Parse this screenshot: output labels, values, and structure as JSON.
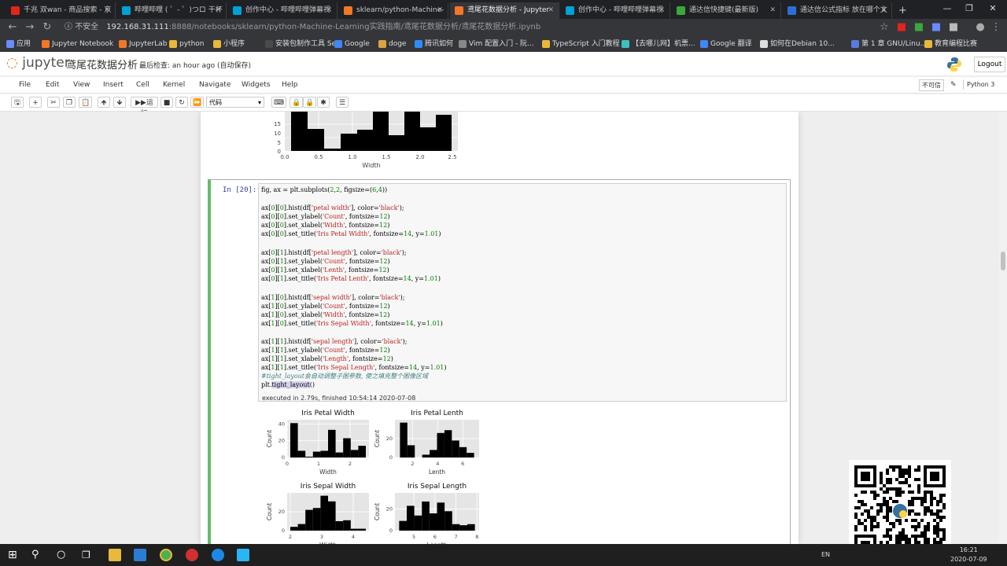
{
  "browser": {
    "tabs": [
      {
        "label": "千兆 双wan - 商品搜索 - 京",
        "color": "#e1251b",
        "icon": "jd-icon"
      },
      {
        "label": "哔哩哔哩 ( ゜- ゜)つロ 干杯",
        "color": "#00a1d6",
        "icon": "bilibili-icon"
      },
      {
        "label": "创作中心 - 哔哩哔哩弹幕视",
        "color": "#00a1d6",
        "icon": "bilibili-icon"
      },
      {
        "label": "sklearn/python-Machine-",
        "color": "#f37726",
        "icon": "jupyter-icon"
      },
      {
        "label": "鸢尾花数据分析 - Jupyter",
        "color": "#f37726",
        "icon": "jupyter-icon"
      },
      {
        "label": "创作中心 - 哔哩哔哩弹幕视",
        "color": "#00a1d6",
        "icon": "bilibili-icon"
      },
      {
        "label": "通达信快捷键(最新版)",
        "color": "#3ca83c",
        "icon": "doc-icon"
      },
      {
        "label": "通达信公式指标 放在哪个文",
        "color": "#2b6fd6",
        "icon": "baidu-icon"
      }
    ],
    "active_tab": 4,
    "new_tab": "+",
    "url_security": "不安全",
    "url_host": "192.168.31.111",
    "url_path": ":8888/notebooks/sklearn/python-Machine-Learning实践指南/鸢尾花数据分析/鸢尾花数据分析.ipynb",
    "bookmarks": [
      {
        "label": "应用",
        "color": "#6a8cff"
      },
      {
        "label": "Jupyter Notebook",
        "color": "#f37726"
      },
      {
        "label": "JupyterLab",
        "color": "#f37726"
      },
      {
        "label": "python",
        "color": "#e8b93a"
      },
      {
        "label": "小程序",
        "color": "#e8b93a"
      },
      {
        "label": "安装包制作工具 Se...",
        "color": "#4a4a4a"
      },
      {
        "label": "Google",
        "color": "#4285f4"
      },
      {
        "label": "doge",
        "color": "#d9a441"
      },
      {
        "label": "腾讯如何",
        "color": "#2e8bff"
      },
      {
        "label": "Vim 配置入门 - 阮...",
        "color": "#888888"
      },
      {
        "label": "TypeScript 入门教程",
        "color": "#e8b93a"
      },
      {
        "label": "【去哪儿网】机票...",
        "color": "#3cc0c0"
      },
      {
        "label": "Google 翻译",
        "color": "#4285f4"
      },
      {
        "label": "如何在Debian 10...",
        "color": "#dddddd"
      },
      {
        "label": "第 1 章 GNU/Linu...",
        "color": "#5a7adf"
      },
      {
        "label": "教育编程比赛",
        "color": "#e8b93a"
      }
    ]
  },
  "jupyter": {
    "logo_text": "jupyter",
    "notebook_name": "鸢尾花数据分析",
    "checkpoint": "最后检查: an hour ago  (自动保存)",
    "logout": "Logout",
    "menu": [
      "File",
      "Edit",
      "View",
      "Insert",
      "Cell",
      "Kernel",
      "Navigate",
      "Widgets",
      "Help"
    ],
    "trusted": "不可信",
    "kernel": "Python 3",
    "run_label": "运行",
    "cell_type": "代码"
  },
  "cell": {
    "prompt": "In  [20]:",
    "execution_info": "executed in 2.79s, finished 10:54:14 2020-07-08"
  },
  "top_plot": {
    "yticks": [
      "15",
      "10",
      "5",
      "0"
    ],
    "xticks": [
      "0.0",
      "0.5",
      "1.0",
      "1.5",
      "2.0",
      "2.5"
    ],
    "xlabel": "Width"
  },
  "chart_data": [
    {
      "type": "bar",
      "title": "Iris Petal Width",
      "xlabel": "Width",
      "ylabel": "Count",
      "xlim": [
        0,
        2.6
      ],
      "ylim": [
        0,
        45
      ],
      "yticks": [
        "40",
        "20",
        "0"
      ],
      "xticks": [
        "0",
        "1",
        "2"
      ],
      "xtick_values": [
        0,
        1,
        2
      ],
      "ytick_values": [
        40,
        20,
        0
      ],
      "bins": [
        0.1,
        0.34,
        0.58,
        0.82,
        1.06,
        1.3,
        1.54,
        1.78,
        2.02,
        2.26,
        2.5
      ],
      "values": [
        41,
        8,
        1,
        7,
        8,
        33,
        6,
        23,
        9,
        14
      ]
    },
    {
      "type": "bar",
      "title": "Iris Petal Lenth",
      "xlabel": "Lenth",
      "ylabel": "Count",
      "xlim": [
        0.6,
        7.3
      ],
      "ylim": [
        0,
        40
      ],
      "yticks": [
        "20",
        "0"
      ],
      "xticks": [
        "2",
        "4",
        "6"
      ],
      "xtick_values": [
        2,
        4,
        6
      ],
      "ytick_values": [
        20,
        0
      ],
      "bins": [
        1.0,
        1.59,
        2.18,
        2.77,
        3.36,
        3.95,
        4.54,
        5.13,
        5.72,
        6.31,
        6.9
      ],
      "values": [
        37,
        13,
        0,
        3,
        8,
        26,
        29,
        18,
        11,
        5
      ]
    },
    {
      "type": "bar",
      "title": "Iris Sepal Width",
      "xlabel": "Width",
      "ylabel": "Count",
      "xlim": [
        1.9,
        4.5
      ],
      "ylim": [
        0,
        40
      ],
      "yticks": [
        "20",
        "0"
      ],
      "xticks": [
        "2",
        "3",
        "4"
      ],
      "xtick_values": [
        2,
        3,
        4
      ],
      "ytick_values": [
        20,
        0
      ],
      "bins": [
        2.0,
        2.24,
        2.48,
        2.72,
        2.96,
        3.2,
        3.44,
        3.68,
        3.92,
        4.16,
        4.4
      ],
      "values": [
        4,
        7,
        22,
        24,
        37,
        31,
        10,
        11,
        2,
        2
      ]
    },
    {
      "type": "bar",
      "title": "Iris Sepal Length",
      "xlabel": "Length",
      "ylabel": "Count",
      "xlim": [
        4.1,
        8.1
      ],
      "ylim": [
        0,
        35
      ],
      "yticks": [
        "20",
        "0"
      ],
      "xticks": [
        "5",
        "6",
        "7",
        "8"
      ],
      "xtick_values": [
        5,
        6,
        7,
        8
      ],
      "ytick_values": [
        20,
        0
      ],
      "bins": [
        4.3,
        4.66,
        5.02,
        5.38,
        5.74,
        6.1,
        6.46,
        6.82,
        7.18,
        7.54,
        7.9
      ],
      "values": [
        9,
        23,
        14,
        27,
        16,
        26,
        18,
        6,
        5,
        6
      ]
    }
  ],
  "taskbar": {
    "time": "16:21",
    "date": "2020-07-09",
    "lang": "EN"
  }
}
